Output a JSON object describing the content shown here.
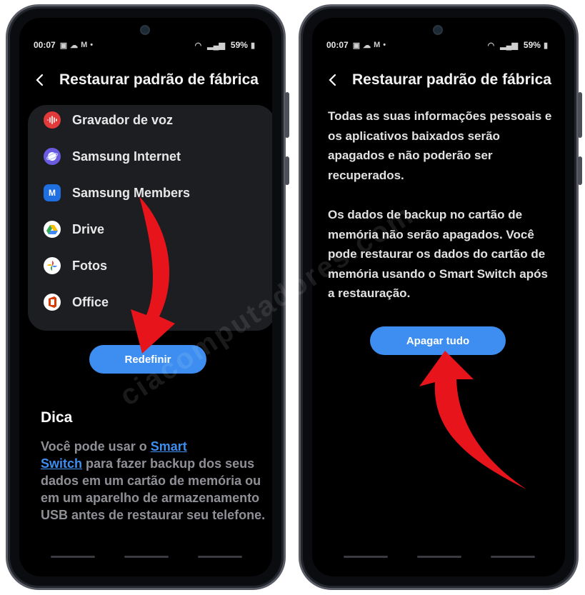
{
  "status_bar": {
    "time": "00:07",
    "battery": "59%"
  },
  "left_screen": {
    "title": "Restaurar padrão de fábrica",
    "apps": [
      {
        "label": "Gravador de voz",
        "icon": "voice-recorder-icon",
        "color": "#e23a3a"
      },
      {
        "label": "Samsung Internet",
        "icon": "samsung-internet-icon",
        "color": "#6a5be0"
      },
      {
        "label": "Samsung Members",
        "icon": "samsung-members-icon",
        "color": "#1f6fe0"
      },
      {
        "label": "Drive",
        "icon": "drive-icon",
        "color": "#ffffff"
      },
      {
        "label": "Fotos",
        "icon": "photos-icon",
        "color": "#ffffff"
      },
      {
        "label": "Office",
        "icon": "office-icon",
        "color": "#ffffff"
      }
    ],
    "button_label": "Redefinir",
    "tip_title": "Dica",
    "tip_text_before": "Você pode usar o ",
    "tip_link_1": "Smart",
    "tip_link_2": "Switch",
    "tip_text_after": " para fazer backup dos seus dados em um cartão de memória ou em um aparelho de armazenamento USB antes de restaurar seu telefone."
  },
  "right_screen": {
    "title": "Restaurar padrão de fábrica",
    "paragraph_1": "Todas as suas informações pessoais e os aplicativos baixados serão apagados e não poderão ser recuperados.",
    "paragraph_2": "Os dados de backup no cartão de memória não serão apagados. Você pode restaurar os dados do cartão de memória usando o Smart Switch após a restauração.",
    "button_label": "Apagar tudo"
  },
  "watermark": "ciacomputadores.com",
  "colors": {
    "accent": "#3d8ef0",
    "arrow": "#e8141b",
    "card": "#1d1e22"
  }
}
